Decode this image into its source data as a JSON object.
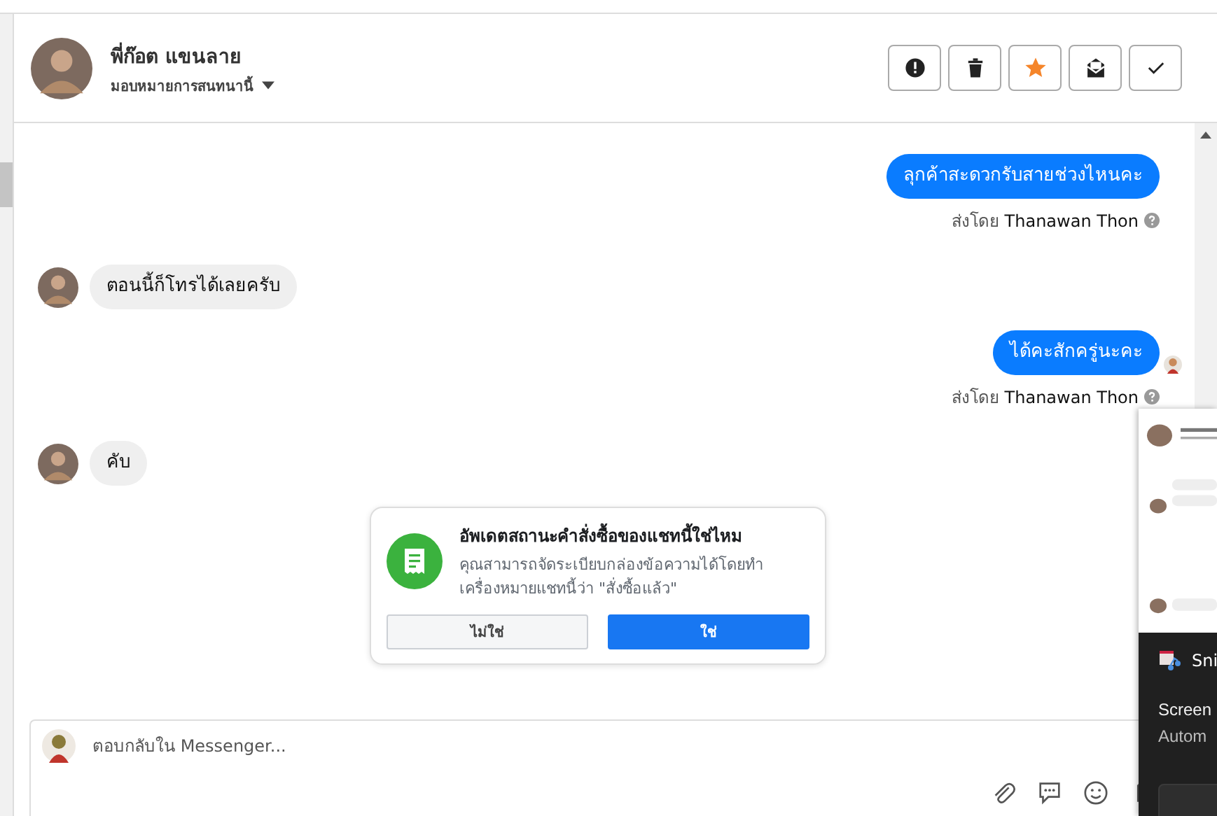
{
  "contact": {
    "name": "พี่ก๊อต แขนลาย",
    "assign_label": "มอบหมายการสนทนานี้"
  },
  "toolbar": [
    {
      "kind": "alert",
      "on": false
    },
    {
      "kind": "trash",
      "on": false
    },
    {
      "kind": "star",
      "on": true
    },
    {
      "kind": "mail",
      "on": false
    },
    {
      "kind": "check",
      "on": false
    }
  ],
  "messages": [
    {
      "kind": "outgoing",
      "text": "ลุกค้าสะดวกรับสายช่วงไหนคะ",
      "sent_by_label": "ส่งโดย",
      "sender": "Thanawan Thon",
      "seen": false
    },
    {
      "kind": "incoming",
      "text": "ตอนนี้ก็โทรได้เลยครับ"
    },
    {
      "kind": "outgoing",
      "text": "ได้คะสักครู่นะคะ",
      "sent_by_label": "ส่งโดย",
      "sender": "Thanawan Thon",
      "seen": true
    },
    {
      "kind": "incoming",
      "text": "คับ"
    }
  ],
  "prompt": {
    "title": "อัพเดตสถานะคำสั่งซื้อของแชทนี้ใช่ไหม",
    "body": "คุณสามารถจัดระเบียบกล่องข้อความได้โดยทำเครื่องหมายแชทนี้ว่า \"สั่งซื้อแล้ว\"",
    "buttons": [
      {
        "label": "ไม่ใช่",
        "kind": "secondary"
      },
      {
        "label": "ใช่",
        "kind": "primary"
      }
    ]
  },
  "composer": {
    "placeholder": "ตอบกลับใน Messenger..."
  },
  "overlay": {
    "app_title": "Sni",
    "lines": [
      "Screen",
      "Autom"
    ]
  }
}
